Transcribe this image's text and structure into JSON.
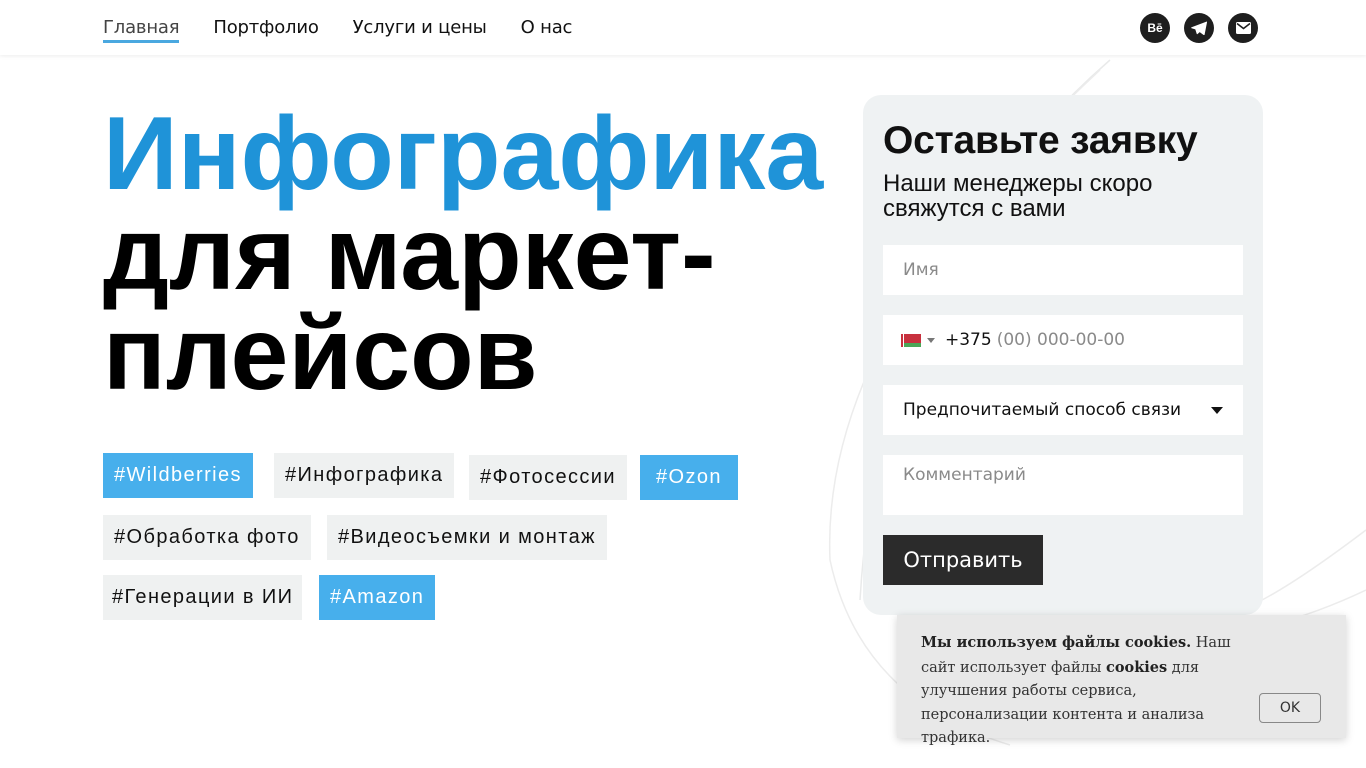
{
  "nav": {
    "items": [
      {
        "label": "Главная",
        "active": true
      },
      {
        "label": "Портфолио",
        "active": false
      },
      {
        "label": "Услуги и цены",
        "active": false
      },
      {
        "label": "О нас",
        "active": false
      }
    ],
    "accent_color": "#4aa8e0"
  },
  "socials": [
    {
      "name": "behance",
      "icon": "behance-icon",
      "text": "Bē"
    },
    {
      "name": "telegram",
      "icon": "telegram-icon"
    },
    {
      "name": "email",
      "icon": "mail-icon"
    }
  ],
  "hero": {
    "title_accent": "Инфографика",
    "title_rest": "для маркет-плейсов",
    "accent_color": "#1f93d8"
  },
  "tags": [
    {
      "label": "#Wildberries",
      "style": "blue"
    },
    {
      "label": "#Инфографика",
      "style": "grey"
    },
    {
      "label": "#Фотосессии",
      "style": "grey"
    },
    {
      "label": "#Ozon",
      "style": "blue"
    },
    {
      "label": "#Обработка фото",
      "style": "grey"
    },
    {
      "label": "#Видеосъемки и монтаж",
      "style": "grey"
    },
    {
      "label": "#Генерации в ИИ",
      "style": "grey"
    },
    {
      "label": "#Amazon",
      "style": "blue"
    }
  ],
  "form": {
    "title": "Оставьте заявку",
    "subtitle": "Наши менеджеры скоро свяжутся с вами",
    "name_placeholder": "Имя",
    "phone_code": "+375",
    "phone_placeholder": "(00) 000-00-00",
    "phone_flag_icon": "belarus-flag-icon",
    "contact_method_selected": "Предпочитаемый способ связи",
    "comment_placeholder": "Комментарий",
    "submit_label": "Отправить"
  },
  "cookie": {
    "title": "Мы используем файлы cookies.",
    "text_before": " Наш сайт использует файлы ",
    "text_bold": "cookies",
    "text_after": " для улучшения работы сервиса, персонализации контента и анализа трафика.",
    "ok_label": "OK"
  }
}
